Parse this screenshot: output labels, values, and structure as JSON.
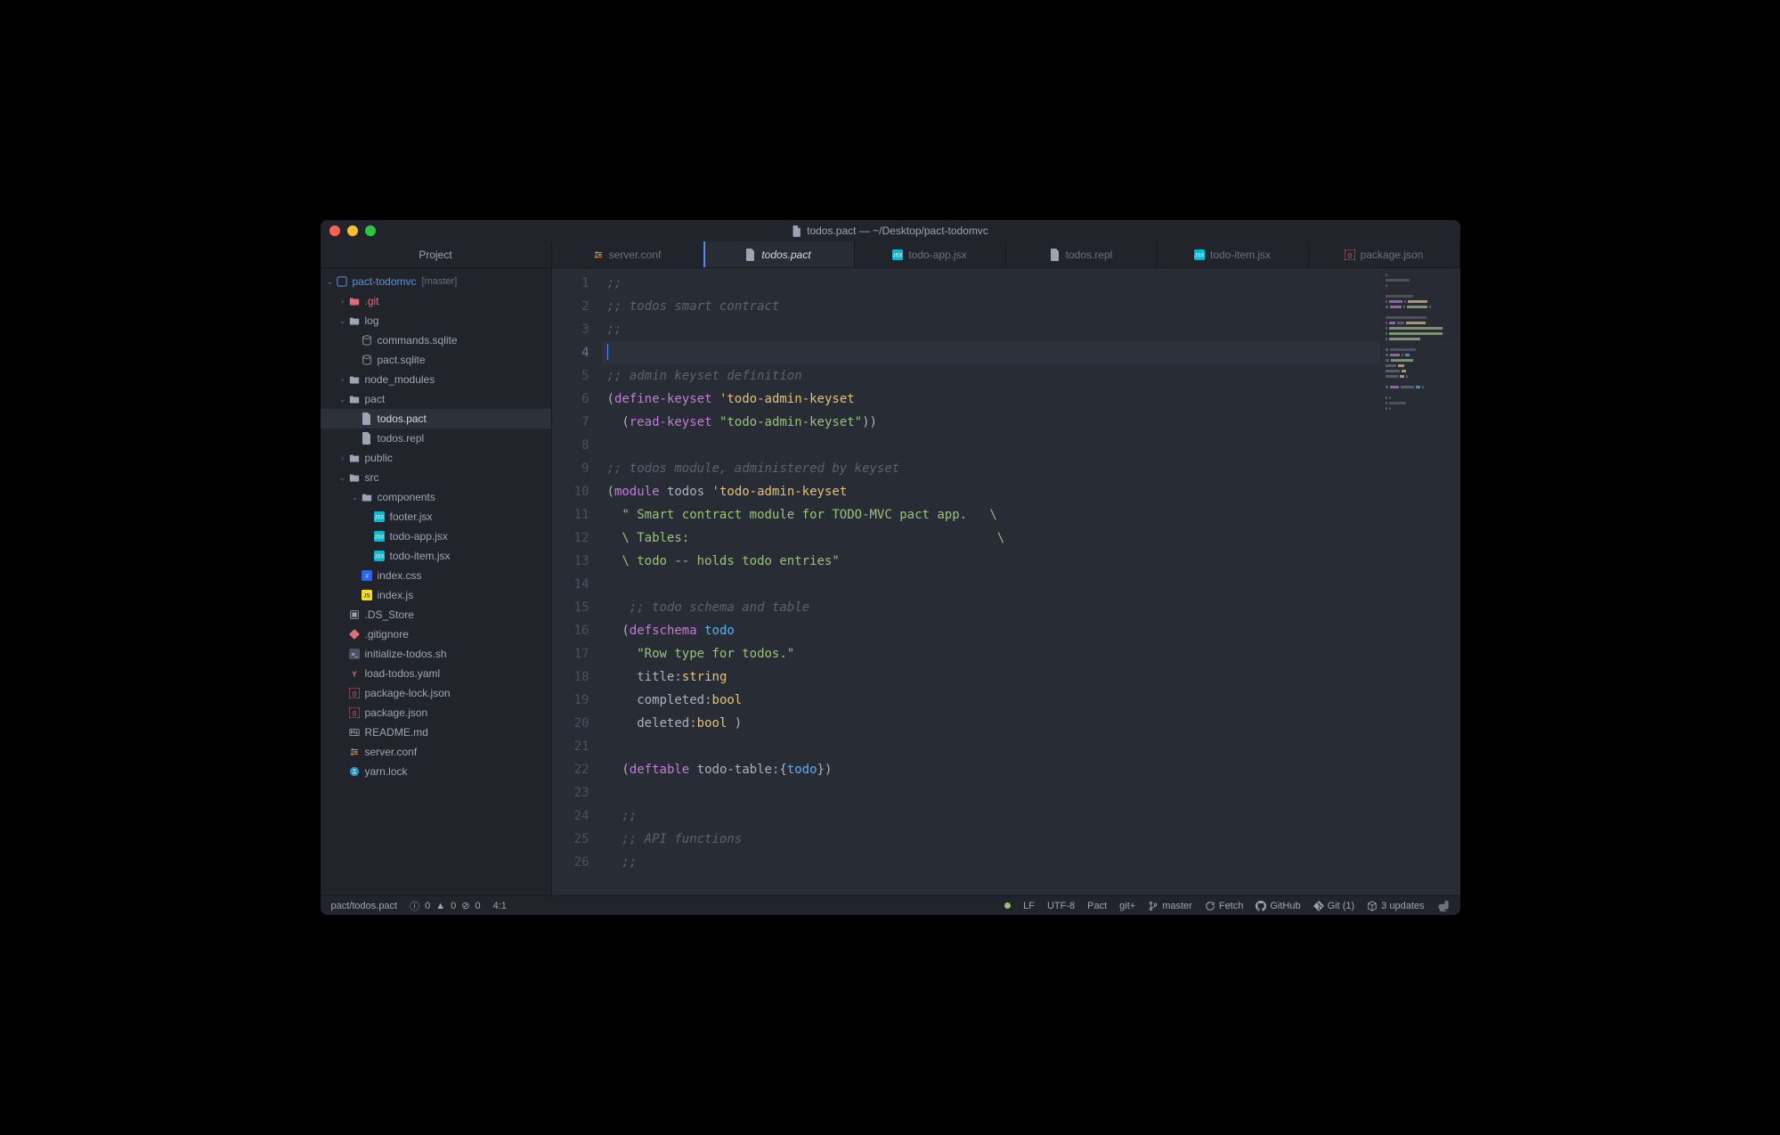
{
  "window": {
    "title": "todos.pact — ~/Desktop/pact-todomvc"
  },
  "sidebar": {
    "header": "Project",
    "root": {
      "name": "pact-todomvc",
      "branch": "[master]"
    },
    "items": [
      {
        "label": ".git",
        "type": "folder",
        "indent": 1,
        "chev": "›",
        "color": "#e06c75"
      },
      {
        "label": "log",
        "type": "folder",
        "indent": 1,
        "chev": "⌄"
      },
      {
        "label": "commands.sqlite",
        "type": "file",
        "indent": 2,
        "icon": "db"
      },
      {
        "label": "pact.sqlite",
        "type": "file",
        "indent": 2,
        "icon": "db"
      },
      {
        "label": "node_modules",
        "type": "folder",
        "indent": 1,
        "chev": "›",
        "icon": "node"
      },
      {
        "label": "pact",
        "type": "folder",
        "indent": 1,
        "chev": "⌄"
      },
      {
        "label": "todos.pact",
        "type": "file",
        "indent": 2,
        "icon": "file",
        "active": true
      },
      {
        "label": "todos.repl",
        "type": "file",
        "indent": 2,
        "icon": "file"
      },
      {
        "label": "public",
        "type": "folder",
        "indent": 1,
        "chev": "›"
      },
      {
        "label": "src",
        "type": "folder",
        "indent": 1,
        "chev": "⌄"
      },
      {
        "label": "components",
        "type": "folder",
        "indent": 2,
        "chev": "⌄"
      },
      {
        "label": "footer.jsx",
        "type": "file",
        "indent": 3,
        "icon": "jsx"
      },
      {
        "label": "todo-app.jsx",
        "type": "file",
        "indent": 3,
        "icon": "jsx"
      },
      {
        "label": "todo-item.jsx",
        "type": "file",
        "indent": 3,
        "icon": "jsx"
      },
      {
        "label": "index.css",
        "type": "file",
        "indent": 2,
        "icon": "css"
      },
      {
        "label": "index.js",
        "type": "file",
        "indent": 2,
        "icon": "js"
      },
      {
        "label": ".DS_Store",
        "type": "file",
        "indent": 1,
        "icon": "ds"
      },
      {
        "label": ".gitignore",
        "type": "file",
        "indent": 1,
        "icon": "git"
      },
      {
        "label": "initialize-todos.sh",
        "type": "file",
        "indent": 1,
        "icon": "sh"
      },
      {
        "label": "load-todos.yaml",
        "type": "file",
        "indent": 1,
        "icon": "yaml"
      },
      {
        "label": "package-lock.json",
        "type": "file",
        "indent": 1,
        "icon": "json"
      },
      {
        "label": "package.json",
        "type": "file",
        "indent": 1,
        "icon": "json"
      },
      {
        "label": "README.md",
        "type": "file",
        "indent": 1,
        "icon": "md"
      },
      {
        "label": "server.conf",
        "type": "file",
        "indent": 1,
        "icon": "conf"
      },
      {
        "label": "yarn.lock",
        "type": "file",
        "indent": 1,
        "icon": "yarn"
      }
    ]
  },
  "tabs": [
    {
      "label": "server.conf",
      "icon": "conf"
    },
    {
      "label": "todos.pact",
      "icon": "file",
      "active": true
    },
    {
      "label": "todo-app.jsx",
      "icon": "jsx"
    },
    {
      "label": "todos.repl",
      "icon": "file"
    },
    {
      "label": "todo-item.jsx",
      "icon": "jsx"
    },
    {
      "label": "package.json",
      "icon": "json"
    }
  ],
  "editor": {
    "lines": [
      [
        {
          "c": "comment",
          "t": ";;"
        }
      ],
      [
        {
          "c": "comment",
          "t": ";; todos smart contract"
        }
      ],
      [
        {
          "c": "comment",
          "t": ";;"
        }
      ],
      [
        {
          "c": "cursor",
          "t": ""
        }
      ],
      [
        {
          "c": "comment",
          "t": ";; admin keyset definition"
        }
      ],
      [
        {
          "c": "paren",
          "t": "("
        },
        {
          "c": "fn",
          "t": "define-keyset"
        },
        {
          "c": "paren",
          "t": " "
        },
        {
          "c": "sym",
          "t": "'todo-admin-keyset"
        }
      ],
      [
        {
          "c": "paren",
          "t": "  ("
        },
        {
          "c": "fn",
          "t": "read-keyset"
        },
        {
          "c": "paren",
          "t": " "
        },
        {
          "c": "str",
          "t": "\"todo-admin-keyset\""
        },
        {
          "c": "paren",
          "t": "))"
        }
      ],
      [],
      [
        {
          "c": "comment",
          "t": ";; todos module, administered by keyset"
        }
      ],
      [
        {
          "c": "paren",
          "t": "("
        },
        {
          "c": "fn",
          "t": "module"
        },
        {
          "c": "paren",
          "t": " todos "
        },
        {
          "c": "sym",
          "t": "'todo-admin-keyset"
        }
      ],
      [
        {
          "c": "paren",
          "t": "  "
        },
        {
          "c": "str",
          "t": "\" Smart contract module for TODO-MVC pact app.   \\"
        }
      ],
      [
        {
          "c": "paren",
          "t": "  "
        },
        {
          "c": "str",
          "t": "\\ Tables:                                         \\"
        }
      ],
      [
        {
          "c": "paren",
          "t": "  "
        },
        {
          "c": "str",
          "t": "\\ todo -- holds todo entries\""
        }
      ],
      [],
      [
        {
          "c": "paren",
          "t": "   "
        },
        {
          "c": "comment",
          "t": ";; todo schema and table"
        }
      ],
      [
        {
          "c": "paren",
          "t": "  ("
        },
        {
          "c": "fn",
          "t": "defschema"
        },
        {
          "c": "paren",
          "t": " "
        },
        {
          "c": "kw",
          "t": "todo"
        }
      ],
      [
        {
          "c": "paren",
          "t": "    "
        },
        {
          "c": "str",
          "t": "\"Row type for todos.\""
        }
      ],
      [
        {
          "c": "paren",
          "t": "    title:"
        },
        {
          "c": "type",
          "t": "string"
        }
      ],
      [
        {
          "c": "paren",
          "t": "    completed:"
        },
        {
          "c": "type",
          "t": "bool"
        }
      ],
      [
        {
          "c": "paren",
          "t": "    deleted:"
        },
        {
          "c": "type",
          "t": "bool"
        },
        {
          "c": "paren",
          "t": " )"
        }
      ],
      [],
      [
        {
          "c": "paren",
          "t": "  ("
        },
        {
          "c": "fn",
          "t": "deftable"
        },
        {
          "c": "paren",
          "t": " todo-table:{"
        },
        {
          "c": "kw",
          "t": "todo"
        },
        {
          "c": "paren",
          "t": "})"
        }
      ],
      [],
      [
        {
          "c": "paren",
          "t": "  "
        },
        {
          "c": "comment",
          "t": ";;"
        }
      ],
      [
        {
          "c": "paren",
          "t": "  "
        },
        {
          "c": "comment",
          "t": ";; API functions"
        }
      ],
      [
        {
          "c": "paren",
          "t": "  "
        },
        {
          "c": "comment",
          "t": ";;"
        }
      ]
    ],
    "currentLine": 4
  },
  "status": {
    "path": "pact/todos.pact",
    "diag_info": "0",
    "diag_warn": "0",
    "diag_err": "0",
    "cursor": "4:1",
    "lf": "LF",
    "encoding": "UTF-8",
    "grammar": "Pact",
    "gitplus": "git+",
    "branch": "master",
    "fetch": "Fetch",
    "github": "GitHub",
    "git_count": "Git (1)",
    "updates": "3 updates"
  }
}
